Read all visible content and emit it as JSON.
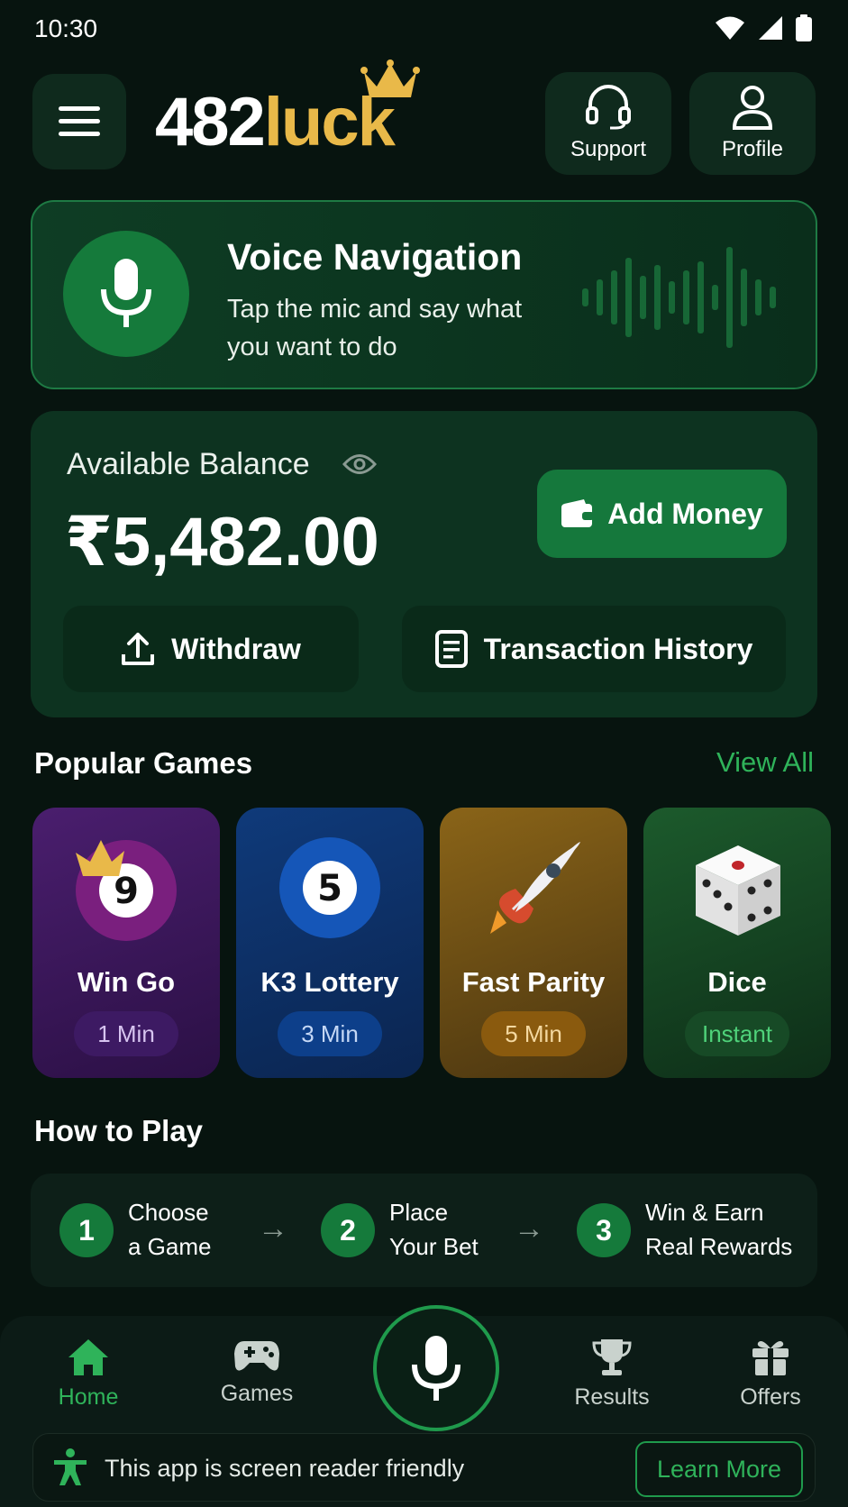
{
  "status": {
    "time": "10:30"
  },
  "header": {
    "logo_num": "482",
    "logo_word": "luck",
    "support_label": "Support",
    "profile_label": "Profile"
  },
  "voice": {
    "title": "Voice Navigation",
    "subtitle": "Tap the mic and say what you want to do"
  },
  "balance": {
    "label": "Available Balance",
    "amount": "₹5,482.00",
    "add_money": "Add Money",
    "withdraw": "Withdraw",
    "history": "Transaction History"
  },
  "games": {
    "title": "Popular Games",
    "view_all": "View All",
    "items": [
      {
        "name": "Win Go",
        "badge": "1 Min",
        "ball": "9"
      },
      {
        "name": "K3 Lottery",
        "badge": "3 Min",
        "ball": "5"
      },
      {
        "name": "Fast Parity",
        "badge": "5 Min"
      },
      {
        "name": "Dice",
        "badge": "Instant"
      }
    ]
  },
  "how_to_play": {
    "title": "How to Play",
    "steps": [
      {
        "num": "1",
        "line1": "Choose",
        "line2": "a Game"
      },
      {
        "num": "2",
        "line1": "Place",
        "line2": "Your Bet"
      },
      {
        "num": "3",
        "line1": "Win & Earn",
        "line2": "Real Rewards"
      }
    ],
    "arrow": "→"
  },
  "nav": {
    "home": "Home",
    "games": "Games",
    "results": "Results",
    "offers": "Offers"
  },
  "a11y": {
    "text": "This app is screen reader friendly",
    "learn_more": "Learn More"
  },
  "colors": {
    "accent": "#157a3b",
    "brand_gold": "#e9b949",
    "link_green": "#2fb35a",
    "background": "#07140f"
  }
}
